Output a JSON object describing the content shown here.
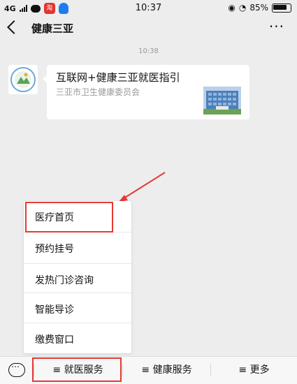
{
  "status_bar": {
    "network": "4G",
    "app_badge": "淘",
    "time": "10:37",
    "mute_icon": "mute-icon",
    "battery": "85%"
  },
  "header": {
    "title": "健康三亚",
    "more": "···"
  },
  "chat": {
    "timestamp": "10:38",
    "card": {
      "title": "互联网+健康三亚就医指引",
      "description": "三亚市卫生健康委员会"
    }
  },
  "popup_menu": {
    "items": [
      {
        "label": "医疗首页"
      },
      {
        "label": "预约挂号"
      },
      {
        "label": "发热门诊咨询"
      },
      {
        "label": "智能导诊"
      },
      {
        "label": "缴费窗口"
      }
    ]
  },
  "bottom_menu": {
    "items": [
      {
        "label": "≡ 就医服务"
      },
      {
        "label": "≡ 健康服务"
      },
      {
        "label": "≡ 更多"
      }
    ]
  },
  "colors": {
    "accent_red": "#e53935",
    "background": "#ededed"
  }
}
